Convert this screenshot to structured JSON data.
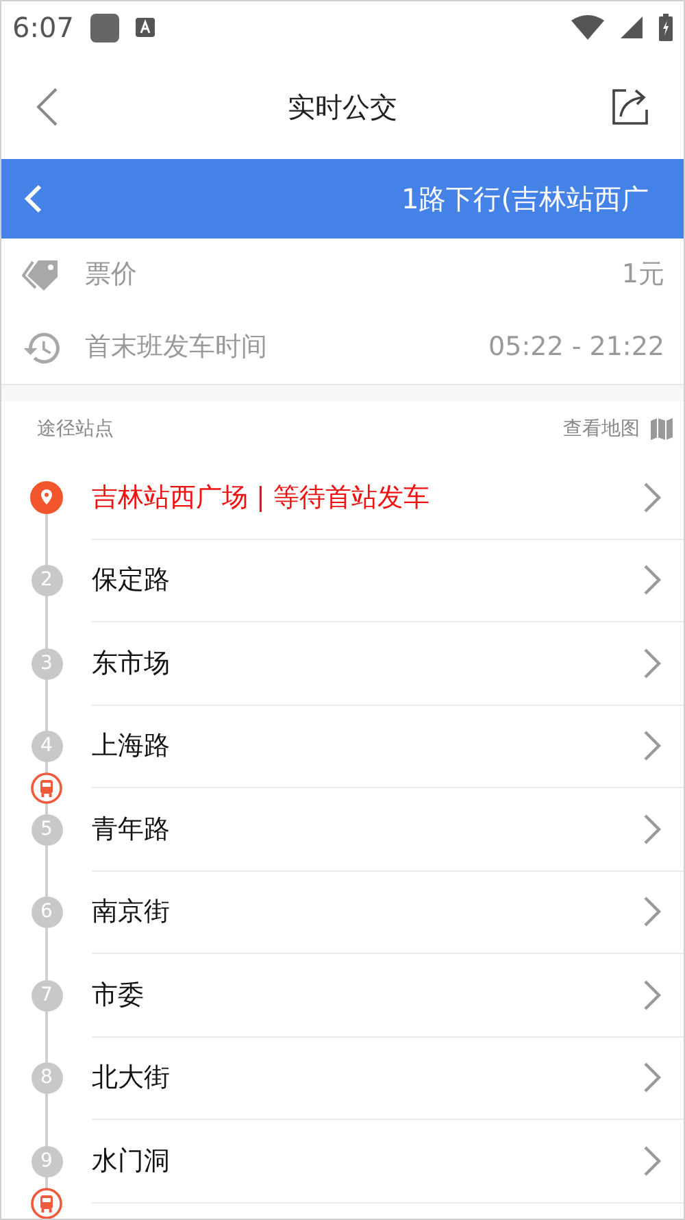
{
  "status_bar": {
    "time": "6:07"
  },
  "header": {
    "title": "实时公交"
  },
  "route_bar": {
    "title": "1路下行(吉林站西广"
  },
  "info": [
    {
      "kind": "price",
      "label": "票价",
      "value": "1元"
    },
    {
      "kind": "schedule",
      "label": "首末班发车时间",
      "value": "05:22 - 21:22"
    }
  ],
  "stops_header": {
    "title": "途径站点",
    "map_link": "查看地图"
  },
  "stops": [
    {
      "kind": "origin",
      "name": "吉林站西广场 | 等待首站发车",
      "bus": false
    },
    {
      "kind": "stop",
      "number": "2",
      "name": "保定路",
      "bus": false
    },
    {
      "kind": "stop",
      "number": "3",
      "name": "东市场",
      "bus": false
    },
    {
      "kind": "stop",
      "number": "4",
      "name": "上海路",
      "bus": true
    },
    {
      "kind": "stop",
      "number": "5",
      "name": "青年路",
      "bus": false
    },
    {
      "kind": "stop",
      "number": "6",
      "name": "南京街",
      "bus": false
    },
    {
      "kind": "stop",
      "number": "7",
      "name": "市委",
      "bus": false
    },
    {
      "kind": "stop",
      "number": "8",
      "name": "北大街",
      "bus": false
    },
    {
      "kind": "stop",
      "number": "9",
      "name": "水门洞",
      "bus": true
    }
  ]
}
